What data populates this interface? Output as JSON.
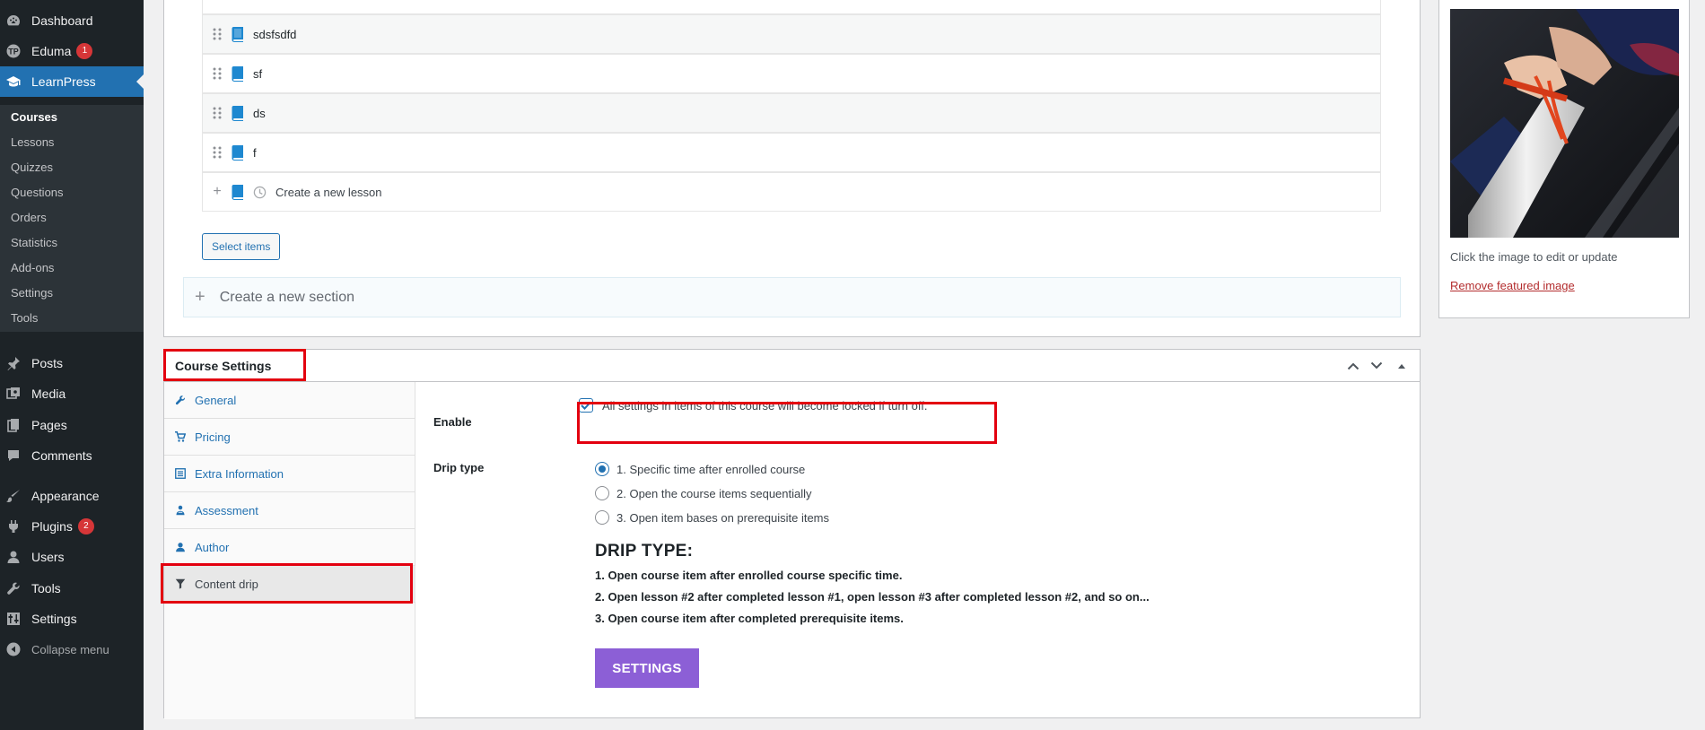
{
  "sidebar": {
    "items": [
      {
        "label": "Dashboard",
        "icon": "dashboard-icon"
      },
      {
        "label": "Eduma",
        "icon": "eduma-icon",
        "badge": "1"
      },
      {
        "label": "LearnPress",
        "icon": "graduation-cap-icon"
      },
      {
        "label": "Posts",
        "icon": "pin-icon"
      },
      {
        "label": "Media",
        "icon": "media-icon"
      },
      {
        "label": "Pages",
        "icon": "pages-icon"
      },
      {
        "label": "Comments",
        "icon": "comments-icon"
      },
      {
        "label": "Appearance",
        "icon": "brush-icon"
      },
      {
        "label": "Plugins",
        "icon": "plugin-icon",
        "badge": "2"
      },
      {
        "label": "Users",
        "icon": "user-icon"
      },
      {
        "label": "Tools",
        "icon": "wrench-icon"
      },
      {
        "label": "Settings",
        "icon": "settings-icon"
      }
    ],
    "submenu": [
      "Courses",
      "Lessons",
      "Quizzes",
      "Questions",
      "Orders",
      "Statistics",
      "Add-ons",
      "Settings",
      "Tools"
    ],
    "collapse_label": "Collapse menu"
  },
  "curriculum": {
    "lessons": [
      "sdsfsdfd",
      "sf",
      "ds",
      "f"
    ],
    "new_lesson_placeholder": "Create a new lesson",
    "select_items_label": "Select items",
    "new_section_placeholder": "Create a new section"
  },
  "featured": {
    "hint": "Click the image to edit or update",
    "remove_label": "Remove featured image"
  },
  "course_settings": {
    "title": "Course Settings",
    "tabs": [
      {
        "label": "General",
        "icon": "wrench-icon"
      },
      {
        "label": "Pricing",
        "icon": "cart-icon"
      },
      {
        "label": "Extra Information",
        "icon": "list-icon"
      },
      {
        "label": "Assessment",
        "icon": "assessment-icon"
      },
      {
        "label": "Author",
        "icon": "author-icon"
      },
      {
        "label": "Content drip",
        "icon": "filter-icon"
      }
    ],
    "active_tab": "Content drip",
    "enable_label": "Enable",
    "enable_checked": true,
    "enable_desc": "All settings in items of this course will become locked if turn off.",
    "drip_type_label": "Drip type",
    "drip_options": [
      "1. Specific time after enrolled course",
      "2. Open the course items sequentially",
      "3. Open item bases on prerequisite items"
    ],
    "drip_selected": 0,
    "drip_heading": "DRIP TYPE:",
    "drip_descriptions": [
      "1. Open course item after enrolled course specific time.",
      "2. Open lesson #2 after completed lesson #1, open lesson #3 after completed lesson #2, and so on...",
      "3. Open course item after completed prerequisite items."
    ],
    "settings_button": "SETTINGS"
  },
  "colors": {
    "sidebar_bg": "#1d2327",
    "accent": "#2271b1",
    "highlight": "#e3000f",
    "settings_button": "#8c5fd6"
  }
}
